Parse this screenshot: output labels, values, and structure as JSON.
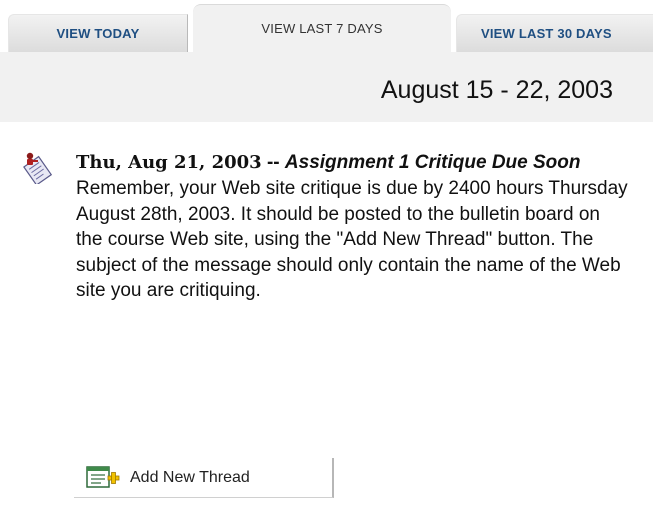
{
  "tabs": [
    {
      "label": "VIEW TODAY",
      "active": false
    },
    {
      "label": "VIEW LAST 7 DAYS",
      "active": true
    },
    {
      "label": "VIEW LAST 30 DAYS",
      "active": false
    }
  ],
  "date_range": "August 15 - 22, 2003",
  "announcement": {
    "date": "Thu, Aug 21, 2003",
    "separator": " -- ",
    "subject": "Assignment 1 Critique Due Soon",
    "body": "Remember, your Web site critique is due by 2400 hours Thursday August 28th, 2003. It should be posted to the bulletin board on the course Web site, using the \"Add New Thread\" button. The subject of the message should only contain the name of the Web site you are critiquing.",
    "icon": "announcement-icon"
  },
  "button": {
    "label": "Add New Thread",
    "icon": "add-thread-icon"
  },
  "colors": {
    "tab_text": "#1f4f82",
    "band": "#f1f1f1"
  }
}
